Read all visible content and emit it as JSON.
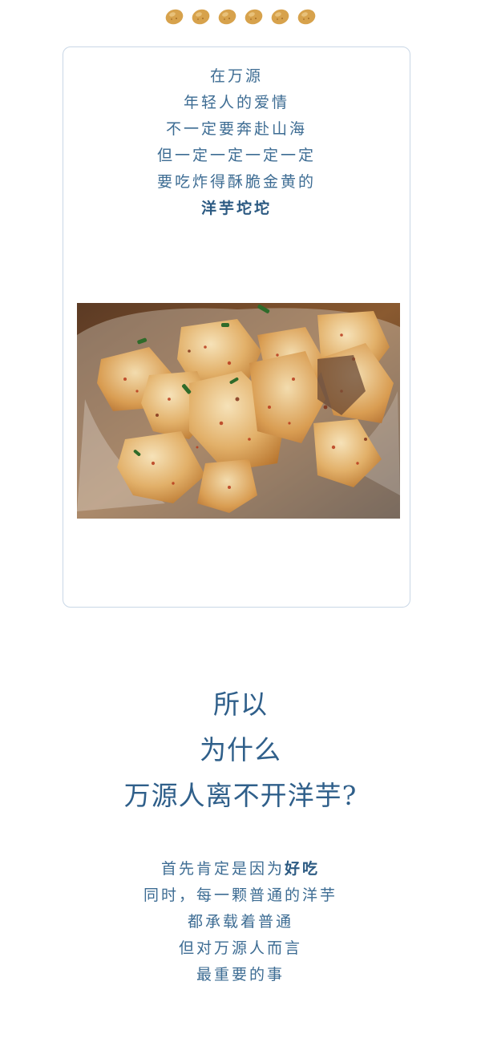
{
  "icons": [
    "potato-icon",
    "potato-icon",
    "potato-icon",
    "potato-icon",
    "potato-icon",
    "potato-icon"
  ],
  "colors": {
    "text": "#3d6c93",
    "heading": "#2f5f8a",
    "card_border": "#c9d7e6",
    "potato": "#d7a24c"
  },
  "card": {
    "lines": [
      "在万源",
      "年轻人的爱情",
      "不一定要奔赴山海",
      "但一定一定一定一定",
      "要吃炸得酥脆金黄的"
    ],
    "emphasis": "洋芋坨坨",
    "photo_icon": "fried-potato-photo"
  },
  "heading": {
    "lines": [
      "所以",
      "为什么",
      "万源人离不开洋芋?"
    ]
  },
  "paragraph": {
    "line1_prefix": "首先肯定是因为",
    "line1_strong": "好吃",
    "lines": [
      "同时，每一颗普通的洋芋",
      "都承载着普通",
      "但对万源人而言",
      "最重要的事"
    ]
  }
}
